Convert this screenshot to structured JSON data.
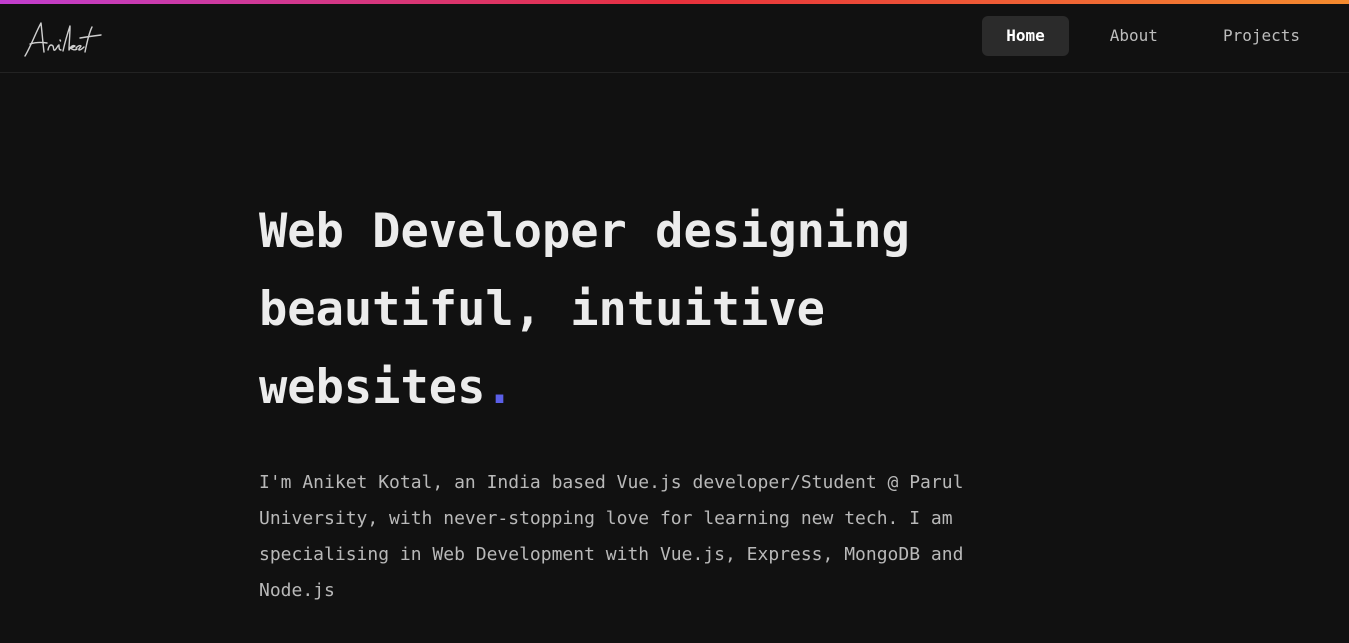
{
  "colors": {
    "background": "#111111",
    "accent": "#5b5fe8",
    "gradient_start": "#c13ecf",
    "gradient_mid": "#e8303c",
    "gradient_end": "#f58b2e"
  },
  "header": {
    "logo_text": "Aniket",
    "nav": [
      {
        "label": "Home",
        "active": true
      },
      {
        "label": "About",
        "active": false
      },
      {
        "label": "Projects",
        "active": false
      }
    ]
  },
  "hero": {
    "title_line1": "Web Developer designing",
    "title_line2": "beautiful, intuitive",
    "title_line3": "websites",
    "title_dot": ".",
    "description": "I'm Aniket Kotal, an India based Vue.js developer/Student @ Parul University, with never-stopping love for learning new tech. I am specialising in Web Development with Vue.js, Express, MongoDB and Node.js"
  }
}
